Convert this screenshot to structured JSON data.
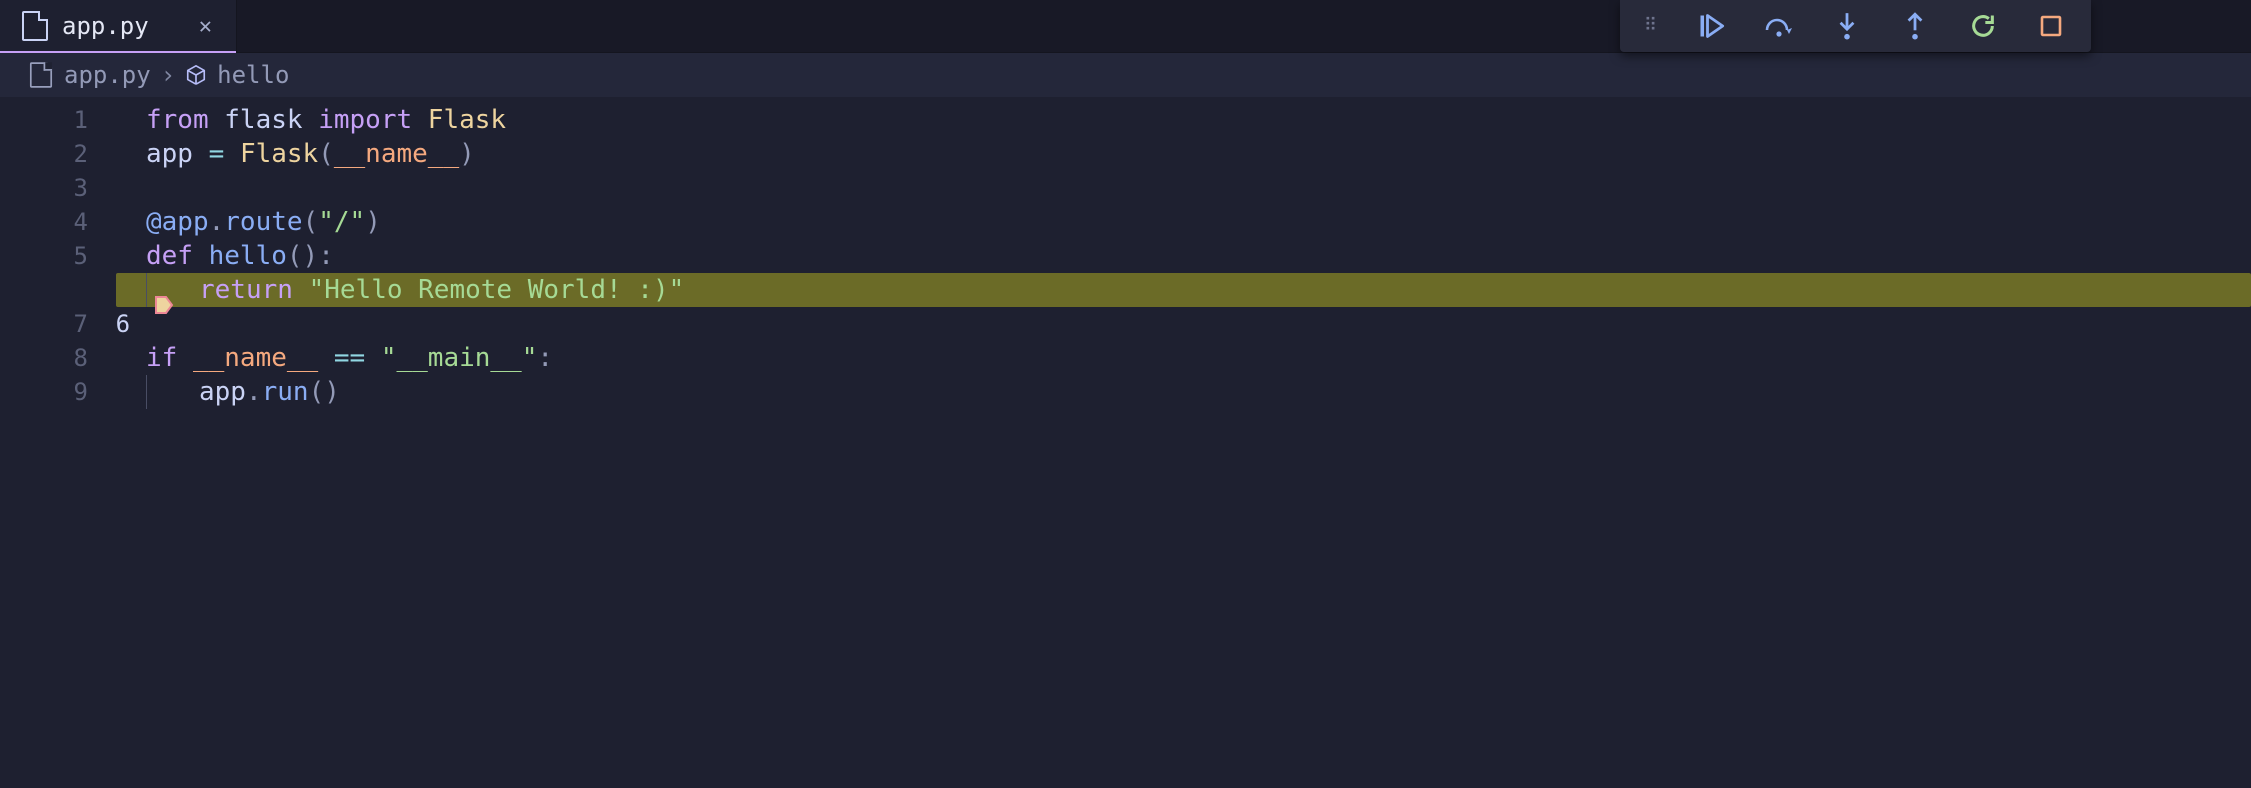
{
  "tab": {
    "filename": "app.py"
  },
  "breadcrumbs": {
    "file": "app.py",
    "symbol": "hello"
  },
  "debug": {
    "continue": "Continue",
    "step_over": "Step Over",
    "step_into": "Step Into",
    "step_out": "Step Out",
    "restart": "Restart",
    "stop": "Stop"
  },
  "editor": {
    "highlighted_line": 6,
    "lines": {
      "1": "from flask import Flask",
      "2": "app = Flask(__name__)",
      "3": "",
      "4": "@app.route(\"/\")",
      "5": "def hello():",
      "6": "    return \"Hello Remote World! :)\"",
      "7": "",
      "8": "if __name__ == \"__main__\":",
      "9": "    app.run()"
    }
  },
  "colors": {
    "bg": "#1e2030",
    "tab_active_underline": "#c6a0f6",
    "line_highlight": "#6b6b27",
    "kw": "#c6a0f6",
    "fn": "#8aadf4",
    "cls": "#eed49f",
    "str": "#a6da95",
    "dunder": "#f5a97f"
  }
}
